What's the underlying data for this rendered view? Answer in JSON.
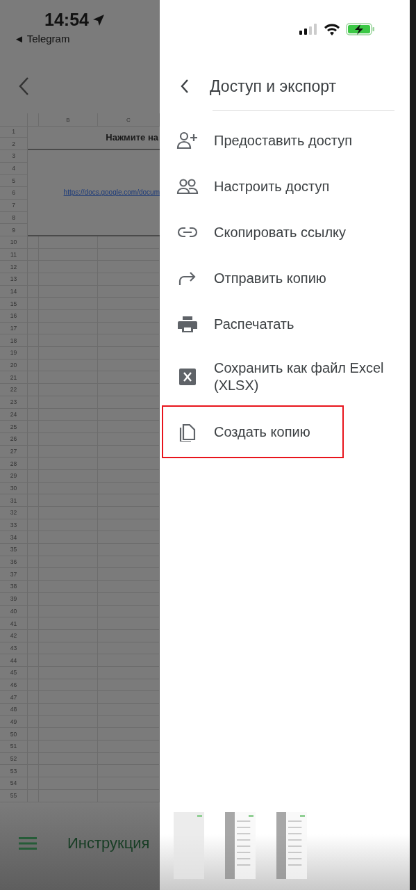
{
  "status_bar": {
    "time": "14:54",
    "back_app": "◄ Telegram"
  },
  "sheet": {
    "columns": [
      "B",
      "C"
    ],
    "title_cell": "Нажмите на",
    "link_cell": "https://docs.google.com/docum",
    "row_numbers": [
      "1",
      "2",
      "3",
      "4",
      "5",
      "6",
      "7",
      "8",
      "9",
      "10",
      "11",
      "12",
      "13",
      "14",
      "15",
      "16",
      "17",
      "18",
      "19",
      "20",
      "21",
      "22",
      "23",
      "24",
      "25",
      "26",
      "27",
      "28",
      "29",
      "30",
      "31",
      "32",
      "33",
      "34",
      "35",
      "36",
      "37",
      "38",
      "39",
      "40",
      "41",
      "42",
      "43",
      "44",
      "45",
      "46",
      "47",
      "48",
      "49",
      "50",
      "51",
      "52",
      "53",
      "54",
      "55"
    ],
    "sheet_tab": "Инструкция"
  },
  "drawer": {
    "title": "Доступ и экспорт",
    "items": [
      {
        "label": "Предоставить доступ",
        "highlighted": false
      },
      {
        "label": "Настроить доступ",
        "highlighted": false
      },
      {
        "label": "Скопировать ссылку",
        "highlighted": false
      },
      {
        "label": "Отправить копию",
        "highlighted": false
      },
      {
        "label": "Распечатать",
        "highlighted": false
      },
      {
        "label": "Сохранить как файл Excel (XLSX)",
        "highlighted": false
      },
      {
        "label": "Создать копию",
        "highlighted": true
      }
    ]
  }
}
